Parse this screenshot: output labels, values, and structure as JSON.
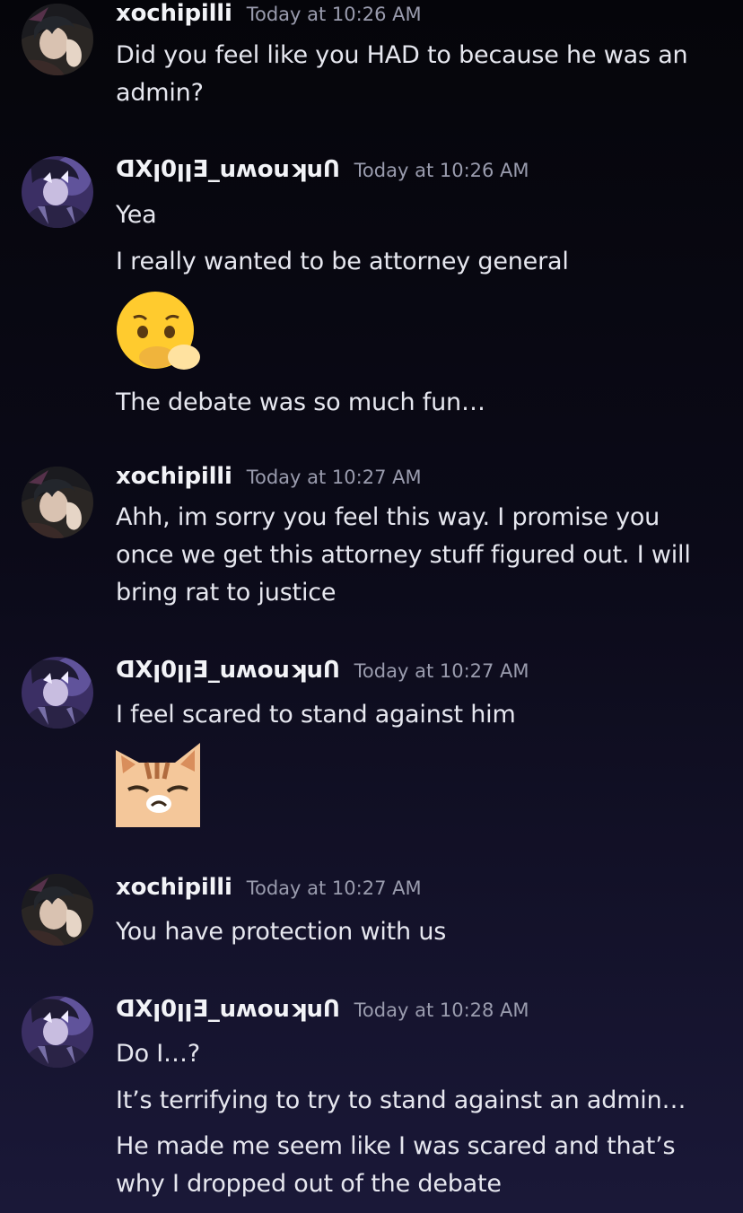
{
  "messages": [
    {
      "username": "xochipilli",
      "timestamp": "Today at 10:26 AM",
      "avatar": "avatar-dark-hair",
      "lines": [
        "Did you feel like you HAD to because he was an",
        "admin?"
      ]
    },
    {
      "username": "ᗡXꞁ0ꞁꞁƎ_uʍouʞuՈ",
      "timestamp": "Today at 10:26 AM",
      "avatar": "avatar-purple",
      "lines": [
        "Yea",
        "I really wanted to be attorney general"
      ],
      "emoji": "pleading-hands-emoji",
      "lines_after": [
        "The debate was so much fun…"
      ]
    },
    {
      "username": "xochipilli",
      "timestamp": "Today at 10:27 AM",
      "avatar": "avatar-dark-hair",
      "lines": [
        "Ahh, im sorry you feel this way. I promise you",
        "once we get this attorney stuff figured out. I will",
        "bring rat to justice"
      ]
    },
    {
      "username": "ᗡXꞁ0ꞁꞁƎ_uʍouʞuՈ",
      "timestamp": "Today at 10:27 AM",
      "avatar": "avatar-purple",
      "lines": [
        "I feel scared to stand against him"
      ],
      "emoji": "grumpy-cat-emoji"
    },
    {
      "username": "xochipilli",
      "timestamp": "Today at 10:27 AM",
      "avatar": "avatar-dark-hair",
      "lines": [
        "You have protection with us"
      ]
    },
    {
      "username": "ᗡXꞁ0ꞁꞁƎ_uʍouʞuՈ",
      "timestamp": "Today at 10:28 AM",
      "avatar": "avatar-purple",
      "lines": [
        "Do I…?",
        "It’s terrifying to try to stand against an admin…",
        "He made me seem like I was scared and that’s",
        "why I dropped out of the debate"
      ]
    }
  ]
}
